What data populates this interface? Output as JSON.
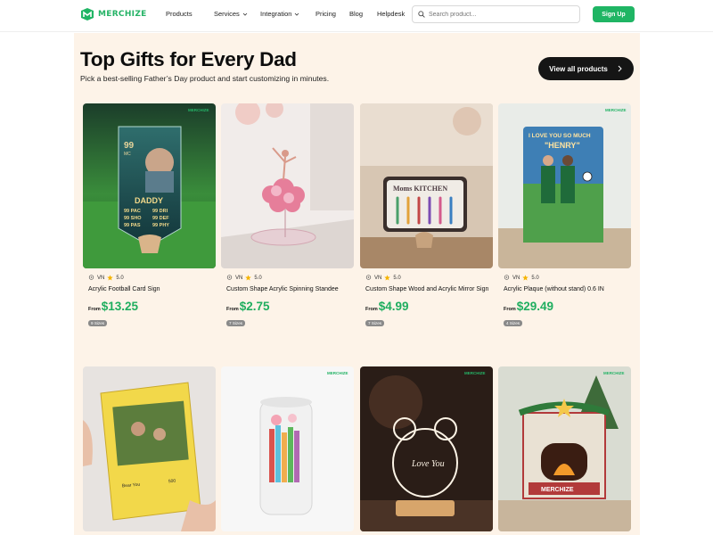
{
  "header": {
    "logo": "MERCHIZE",
    "nav": [
      "Products",
      "Services",
      "Integration",
      "Pricing",
      "Blog",
      "Helpdesk"
    ],
    "nav_dropdown": [
      false,
      true,
      true,
      false,
      false,
      false
    ],
    "search_placeholder": "Search product...",
    "signup": "Sign Up"
  },
  "hero": {
    "title": "Top Gifts for Every Dad",
    "subtitle": "Pick a best-selling Father’s Day product and start customizing in minutes.",
    "view_all": "View all products"
  },
  "products": [
    {
      "origin": "VN",
      "rating": "5.0",
      "name": "Acrylic Football Card Sign",
      "from": "From",
      "price": "$13.25",
      "sizes": "9 Sizes",
      "image": "football-card"
    },
    {
      "origin": "VN",
      "rating": "5.0",
      "name": "Custom Shape Acrylic Spinning Standee",
      "from": "From",
      "price": "$2.75",
      "sizes": "7 Sizes",
      "image": "ballerina-standee"
    },
    {
      "origin": "VN",
      "rating": "5.0",
      "name": "Custom Shape Wood and Acrylic Mirror Sign",
      "from": "From",
      "price": "$4.99",
      "sizes": "7 Sizes",
      "image": "kitchen-sign"
    },
    {
      "origin": "VN",
      "rating": "5.0",
      "name": "Acrylic Plaque (without stand) 0.6 IN",
      "from": "From",
      "price": "$29.49",
      "sizes": "4 Sizes",
      "image": "plaque-henry"
    },
    {
      "image": "trading-card"
    },
    {
      "image": "glass-can"
    },
    {
      "image": "bear-lamp"
    },
    {
      "image": "fireplace-ornament"
    }
  ],
  "image_texts": {
    "football_card_name": "DADDY",
    "football_card_rating": "99",
    "football_card_position": "MC",
    "plaque_line1": "I LOVE YOU SO MUCH",
    "plaque_line2": "\"HENRY\"",
    "kitchen_sign": "Moms KITCHEN",
    "lamp_text": "Love You",
    "ornament_text": "MERCHIZE"
  },
  "colors": {
    "accent": "#1fb564",
    "price": "#1fae5f",
    "section_bg": "#fdf3e8"
  }
}
